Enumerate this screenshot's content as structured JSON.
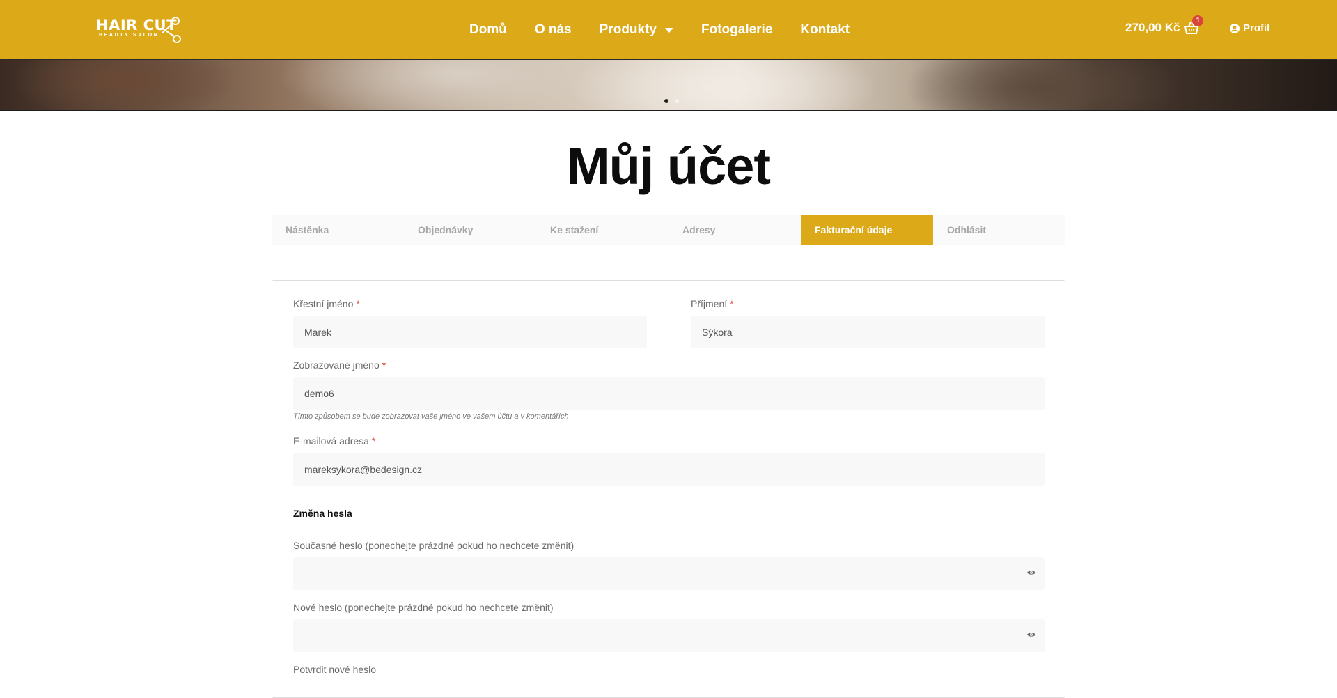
{
  "brand": {
    "line1": "HAIR CUT",
    "line2": "BEAUTY SALON"
  },
  "nav": {
    "items": [
      {
        "label": "Domů"
      },
      {
        "label": "O nás"
      },
      {
        "label": "Produkty"
      },
      {
        "label": "Fotogalerie"
      },
      {
        "label": "Kontakt"
      }
    ]
  },
  "cart": {
    "total": "270,00 Kč",
    "count": "1"
  },
  "profile": {
    "label": "Profil"
  },
  "page": {
    "title": "Můj účet"
  },
  "tabs": [
    {
      "label": "Nástěnka"
    },
    {
      "label": "Objednávky"
    },
    {
      "label": "Ke stažení"
    },
    {
      "label": "Adresy"
    },
    {
      "label": "Fakturační údaje",
      "active": true
    },
    {
      "label": "Odhlásit"
    }
  ],
  "form": {
    "first_name": {
      "label": "Křestní jméno",
      "value": "Marek"
    },
    "last_name": {
      "label": "Příjmení",
      "value": "Sýkora"
    },
    "display_name": {
      "label": "Zobrazované jméno",
      "value": "demo6",
      "hint": "Tímto způsobem se bude zobrazovat vaše jméno ve vašem účtu a v komentářích"
    },
    "email": {
      "label": "E-mailová adresa",
      "value": "mareksykora@bedesign.cz"
    },
    "required_mark": "*",
    "password_section": "Změna hesla",
    "current_password": {
      "label": "Současné heslo (ponechejte prázdné pokud ho nechcete změnit)",
      "value": ""
    },
    "new_password": {
      "label": "Nové heslo (ponechejte prázdné pokud ho nechcete změnit)",
      "value": ""
    },
    "confirm_password": {
      "label": "Potvrdit nové heslo"
    }
  },
  "colors": {
    "accent": "#dcaa19",
    "required": "#d9453a",
    "field_bg": "#f8f8f8"
  }
}
